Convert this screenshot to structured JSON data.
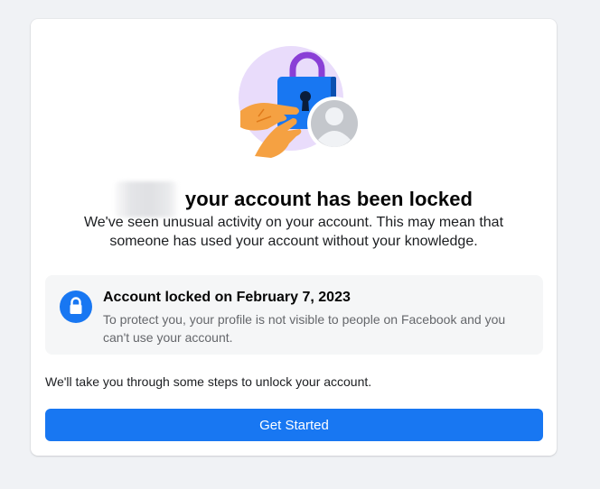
{
  "header": {
    "title": "your account has been locked",
    "subtitle": "We've seen unusual activity on your account. This may mean that someone has used your account without your knowledge."
  },
  "illustration": {
    "icons": [
      "lock-icon",
      "hands-icon",
      "profile-avatar-icon"
    ]
  },
  "status": {
    "icon": "lock-icon",
    "title": "Account locked on February 7, 2023",
    "description": "To protect you, your profile is not visible to people on Facebook and you can't use your account."
  },
  "steps_text": "We'll take you through some steps to unlock your account.",
  "actions": {
    "get_started_label": "Get Started"
  },
  "colors": {
    "accent": "#1877f2",
    "background": "#f0f2f5",
    "card": "#ffffff",
    "status_box": "#f5f6f7",
    "illustration_circle": "#e9dcfb",
    "lock_shackle": "#8a3fd6",
    "hand": "#f5a142"
  }
}
